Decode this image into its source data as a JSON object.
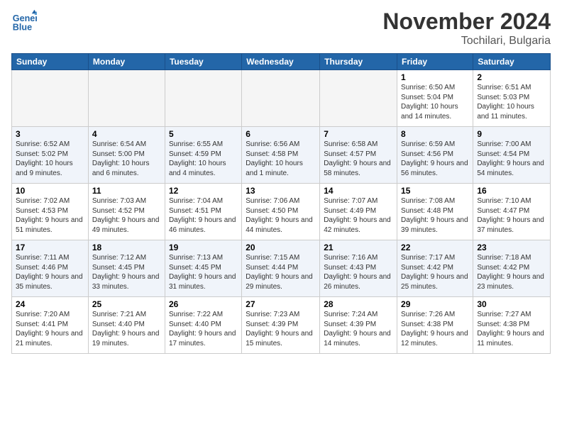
{
  "header": {
    "logo_line1": "General",
    "logo_line2": "Blue",
    "month_title": "November 2024",
    "location": "Tochilari, Bulgaria"
  },
  "days_of_week": [
    "Sunday",
    "Monday",
    "Tuesday",
    "Wednesday",
    "Thursday",
    "Friday",
    "Saturday"
  ],
  "weeks": [
    [
      {
        "day": "",
        "info": ""
      },
      {
        "day": "",
        "info": ""
      },
      {
        "day": "",
        "info": ""
      },
      {
        "day": "",
        "info": ""
      },
      {
        "day": "",
        "info": ""
      },
      {
        "day": "1",
        "info": "Sunrise: 6:50 AM\nSunset: 5:04 PM\nDaylight: 10 hours and 14 minutes."
      },
      {
        "day": "2",
        "info": "Sunrise: 6:51 AM\nSunset: 5:03 PM\nDaylight: 10 hours and 11 minutes."
      }
    ],
    [
      {
        "day": "3",
        "info": "Sunrise: 6:52 AM\nSunset: 5:02 PM\nDaylight: 10 hours and 9 minutes."
      },
      {
        "day": "4",
        "info": "Sunrise: 6:54 AM\nSunset: 5:00 PM\nDaylight: 10 hours and 6 minutes."
      },
      {
        "day": "5",
        "info": "Sunrise: 6:55 AM\nSunset: 4:59 PM\nDaylight: 10 hours and 4 minutes."
      },
      {
        "day": "6",
        "info": "Sunrise: 6:56 AM\nSunset: 4:58 PM\nDaylight: 10 hours and 1 minute."
      },
      {
        "day": "7",
        "info": "Sunrise: 6:58 AM\nSunset: 4:57 PM\nDaylight: 9 hours and 58 minutes."
      },
      {
        "day": "8",
        "info": "Sunrise: 6:59 AM\nSunset: 4:56 PM\nDaylight: 9 hours and 56 minutes."
      },
      {
        "day": "9",
        "info": "Sunrise: 7:00 AM\nSunset: 4:54 PM\nDaylight: 9 hours and 54 minutes."
      }
    ],
    [
      {
        "day": "10",
        "info": "Sunrise: 7:02 AM\nSunset: 4:53 PM\nDaylight: 9 hours and 51 minutes."
      },
      {
        "day": "11",
        "info": "Sunrise: 7:03 AM\nSunset: 4:52 PM\nDaylight: 9 hours and 49 minutes."
      },
      {
        "day": "12",
        "info": "Sunrise: 7:04 AM\nSunset: 4:51 PM\nDaylight: 9 hours and 46 minutes."
      },
      {
        "day": "13",
        "info": "Sunrise: 7:06 AM\nSunset: 4:50 PM\nDaylight: 9 hours and 44 minutes."
      },
      {
        "day": "14",
        "info": "Sunrise: 7:07 AM\nSunset: 4:49 PM\nDaylight: 9 hours and 42 minutes."
      },
      {
        "day": "15",
        "info": "Sunrise: 7:08 AM\nSunset: 4:48 PM\nDaylight: 9 hours and 39 minutes."
      },
      {
        "day": "16",
        "info": "Sunrise: 7:10 AM\nSunset: 4:47 PM\nDaylight: 9 hours and 37 minutes."
      }
    ],
    [
      {
        "day": "17",
        "info": "Sunrise: 7:11 AM\nSunset: 4:46 PM\nDaylight: 9 hours and 35 minutes."
      },
      {
        "day": "18",
        "info": "Sunrise: 7:12 AM\nSunset: 4:45 PM\nDaylight: 9 hours and 33 minutes."
      },
      {
        "day": "19",
        "info": "Sunrise: 7:13 AM\nSunset: 4:45 PM\nDaylight: 9 hours and 31 minutes."
      },
      {
        "day": "20",
        "info": "Sunrise: 7:15 AM\nSunset: 4:44 PM\nDaylight: 9 hours and 29 minutes."
      },
      {
        "day": "21",
        "info": "Sunrise: 7:16 AM\nSunset: 4:43 PM\nDaylight: 9 hours and 26 minutes."
      },
      {
        "day": "22",
        "info": "Sunrise: 7:17 AM\nSunset: 4:42 PM\nDaylight: 9 hours and 25 minutes."
      },
      {
        "day": "23",
        "info": "Sunrise: 7:18 AM\nSunset: 4:42 PM\nDaylight: 9 hours and 23 minutes."
      }
    ],
    [
      {
        "day": "24",
        "info": "Sunrise: 7:20 AM\nSunset: 4:41 PM\nDaylight: 9 hours and 21 minutes."
      },
      {
        "day": "25",
        "info": "Sunrise: 7:21 AM\nSunset: 4:40 PM\nDaylight: 9 hours and 19 minutes."
      },
      {
        "day": "26",
        "info": "Sunrise: 7:22 AM\nSunset: 4:40 PM\nDaylight: 9 hours and 17 minutes."
      },
      {
        "day": "27",
        "info": "Sunrise: 7:23 AM\nSunset: 4:39 PM\nDaylight: 9 hours and 15 minutes."
      },
      {
        "day": "28",
        "info": "Sunrise: 7:24 AM\nSunset: 4:39 PM\nDaylight: 9 hours and 14 minutes."
      },
      {
        "day": "29",
        "info": "Sunrise: 7:26 AM\nSunset: 4:38 PM\nDaylight: 9 hours and 12 minutes."
      },
      {
        "day": "30",
        "info": "Sunrise: 7:27 AM\nSunset: 4:38 PM\nDaylight: 9 hours and 11 minutes."
      }
    ]
  ]
}
